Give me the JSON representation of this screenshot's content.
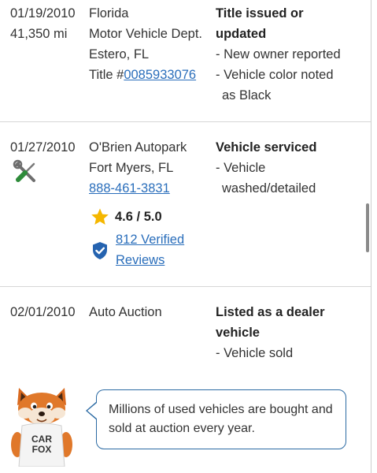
{
  "records": [
    {
      "date": "01/19/2010",
      "mileage": "41,350 mi",
      "source_lines": [
        "Florida",
        "Motor Vehicle Dept.",
        "Estero, FL"
      ],
      "title_prefix": "Title #",
      "title_number": "0085933076",
      "event_lines": [
        "Title issued or",
        "updated"
      ],
      "detail_lines": [
        "- New owner reported",
        "- Vehicle color noted",
        "as Black"
      ]
    },
    {
      "date": "01/27/2010",
      "service_icon": "wrench-screwdriver-icon",
      "source_lines": [
        "O'Brien Autopark",
        "Fort Myers, FL"
      ],
      "phone": "888-461-3831",
      "rating": "4.6 / 5.0",
      "rating_icon": "star-icon",
      "verified_icon": "verified-shield-icon",
      "reviews_lines": [
        "812 Verified",
        "Reviews"
      ],
      "event_lines": [
        "Vehicle serviced"
      ],
      "detail_lines": [
        "- Vehicle",
        "washed/detailed"
      ]
    },
    {
      "date": "02/01/2010",
      "source_lines": [
        "Auto Auction"
      ],
      "event_lines": [
        "Listed as a dealer",
        "vehicle"
      ],
      "detail_lines": [
        "- Vehicle sold"
      ]
    }
  ],
  "mascot": {
    "shirt_line1": "CAR",
    "shirt_line2": "FOX"
  },
  "tip": "Millions of used vehicles are bought and sold at auction every year.",
  "colors": {
    "link": "#2a6ebb",
    "star": "#f5b700",
    "shield": "#2563b0",
    "icon_green": "#2e8b3a",
    "bubble_border": "#2b6aa3",
    "fox_orange": "#e0782a"
  }
}
